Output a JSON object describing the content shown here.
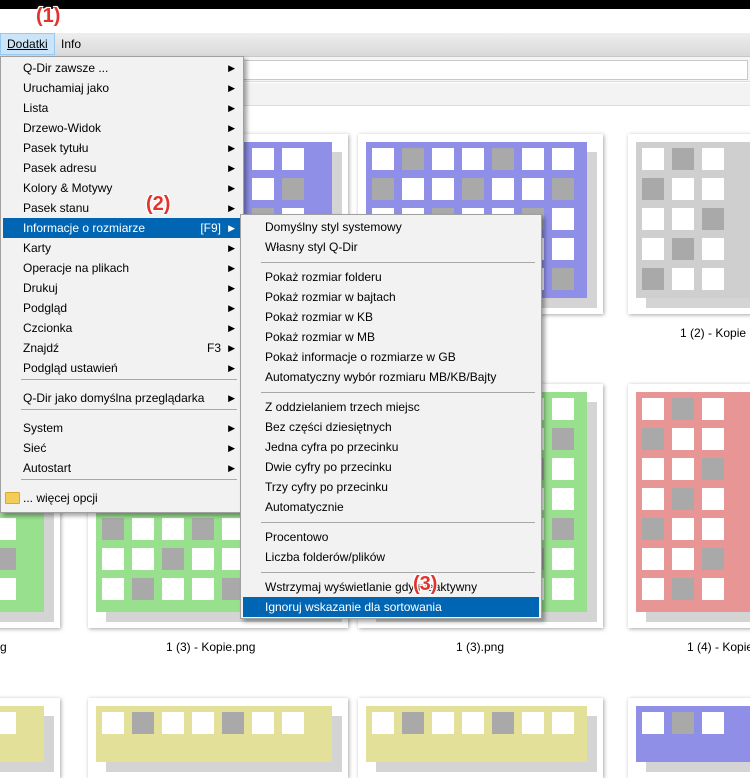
{
  "menubar": {
    "items": [
      {
        "label": "Dodatki"
      },
      {
        "label": "Info"
      }
    ]
  },
  "annotations": {
    "step1": "(1)",
    "step2": "(2)",
    "step3": "(3)"
  },
  "main_menu": {
    "items": [
      {
        "label": "Q-Dir zawsze ...",
        "arrow": "▶"
      },
      {
        "label": "Uruchamiaj jako",
        "arrow": "▶"
      },
      {
        "label": "Lista",
        "arrow": "▶"
      },
      {
        "label": "Drzewo-Widok",
        "arrow": "▶"
      },
      {
        "label": "Pasek tytułu",
        "arrow": "▶"
      },
      {
        "label": "Pasek adresu",
        "arrow": "▶"
      },
      {
        "label": "Kolory & Motywy",
        "arrow": "▶"
      },
      {
        "label": "Pasek stanu",
        "arrow": "▶"
      },
      {
        "label": "Informacje o rozmiarze",
        "shortcut": "[F9]",
        "arrow": "▶"
      },
      {
        "label": "Karty",
        "arrow": "▶"
      },
      {
        "label": "Operacje na plikach",
        "arrow": "▶"
      },
      {
        "label": "Drukuj",
        "arrow": "▶"
      },
      {
        "label": "Podgląd",
        "arrow": "▶"
      },
      {
        "label": "Czcionka",
        "arrow": "▶"
      },
      {
        "label": "Znajdź",
        "shortcut": "F3",
        "arrow": "▶"
      },
      {
        "label": "Podgląd ustawień",
        "arrow": "▶"
      },
      {
        "label": "Q-Dir jako domyślna przeglądarka",
        "arrow": "▶"
      },
      {
        "label": "System",
        "arrow": "▶"
      },
      {
        "label": "Sieć",
        "arrow": "▶"
      },
      {
        "label": "Autostart",
        "arrow": "▶"
      },
      {
        "label": "... więcej opcji"
      }
    ]
  },
  "sub_menu": {
    "items": [
      {
        "label": "Domyślny styl systemowy"
      },
      {
        "label": "Własny styl Q-Dir"
      },
      {
        "label": "Pokaż rozmiar folderu"
      },
      {
        "label": "Pokaż rozmiar w bajtach"
      },
      {
        "label": "Pokaż rozmiar w KB"
      },
      {
        "label": "Pokaż rozmiar w MB"
      },
      {
        "label": "Pokaż informacje o rozmiarze w GB"
      },
      {
        "label": "Automatyczny wybór rozmiaru MB/KB/Bajty"
      },
      {
        "label": "Z oddzielaniem trzech miejsc"
      },
      {
        "label": "Bez części dziesiętnych"
      },
      {
        "label": "Jedna cyfra po przecinku"
      },
      {
        "label": "Dwie cyfry po przecinku"
      },
      {
        "label": "Trzy cyfry po przecinku"
      },
      {
        "label": "Automatycznie"
      },
      {
        "label": "Procentowo"
      },
      {
        "label": "Liczba folderów/plików"
      },
      {
        "label": "Wstrzymaj wyświetlanie gdy nieaktywny"
      },
      {
        "label": "Ignoruj wskazanie dla sortowania"
      }
    ]
  },
  "files": {
    "captions": [
      "1 (2) - Kopie",
      "1 (3) - Kopie.png",
      "1 (3).png",
      "1 (4) - Kopie",
      "g"
    ]
  },
  "colors": {
    "blue": "#8f8fe8",
    "green": "#98df8e",
    "red": "#e89595",
    "gray": "#cfcfcf",
    "yellow": "#e3e09a",
    "highlight": "#0066b3"
  }
}
